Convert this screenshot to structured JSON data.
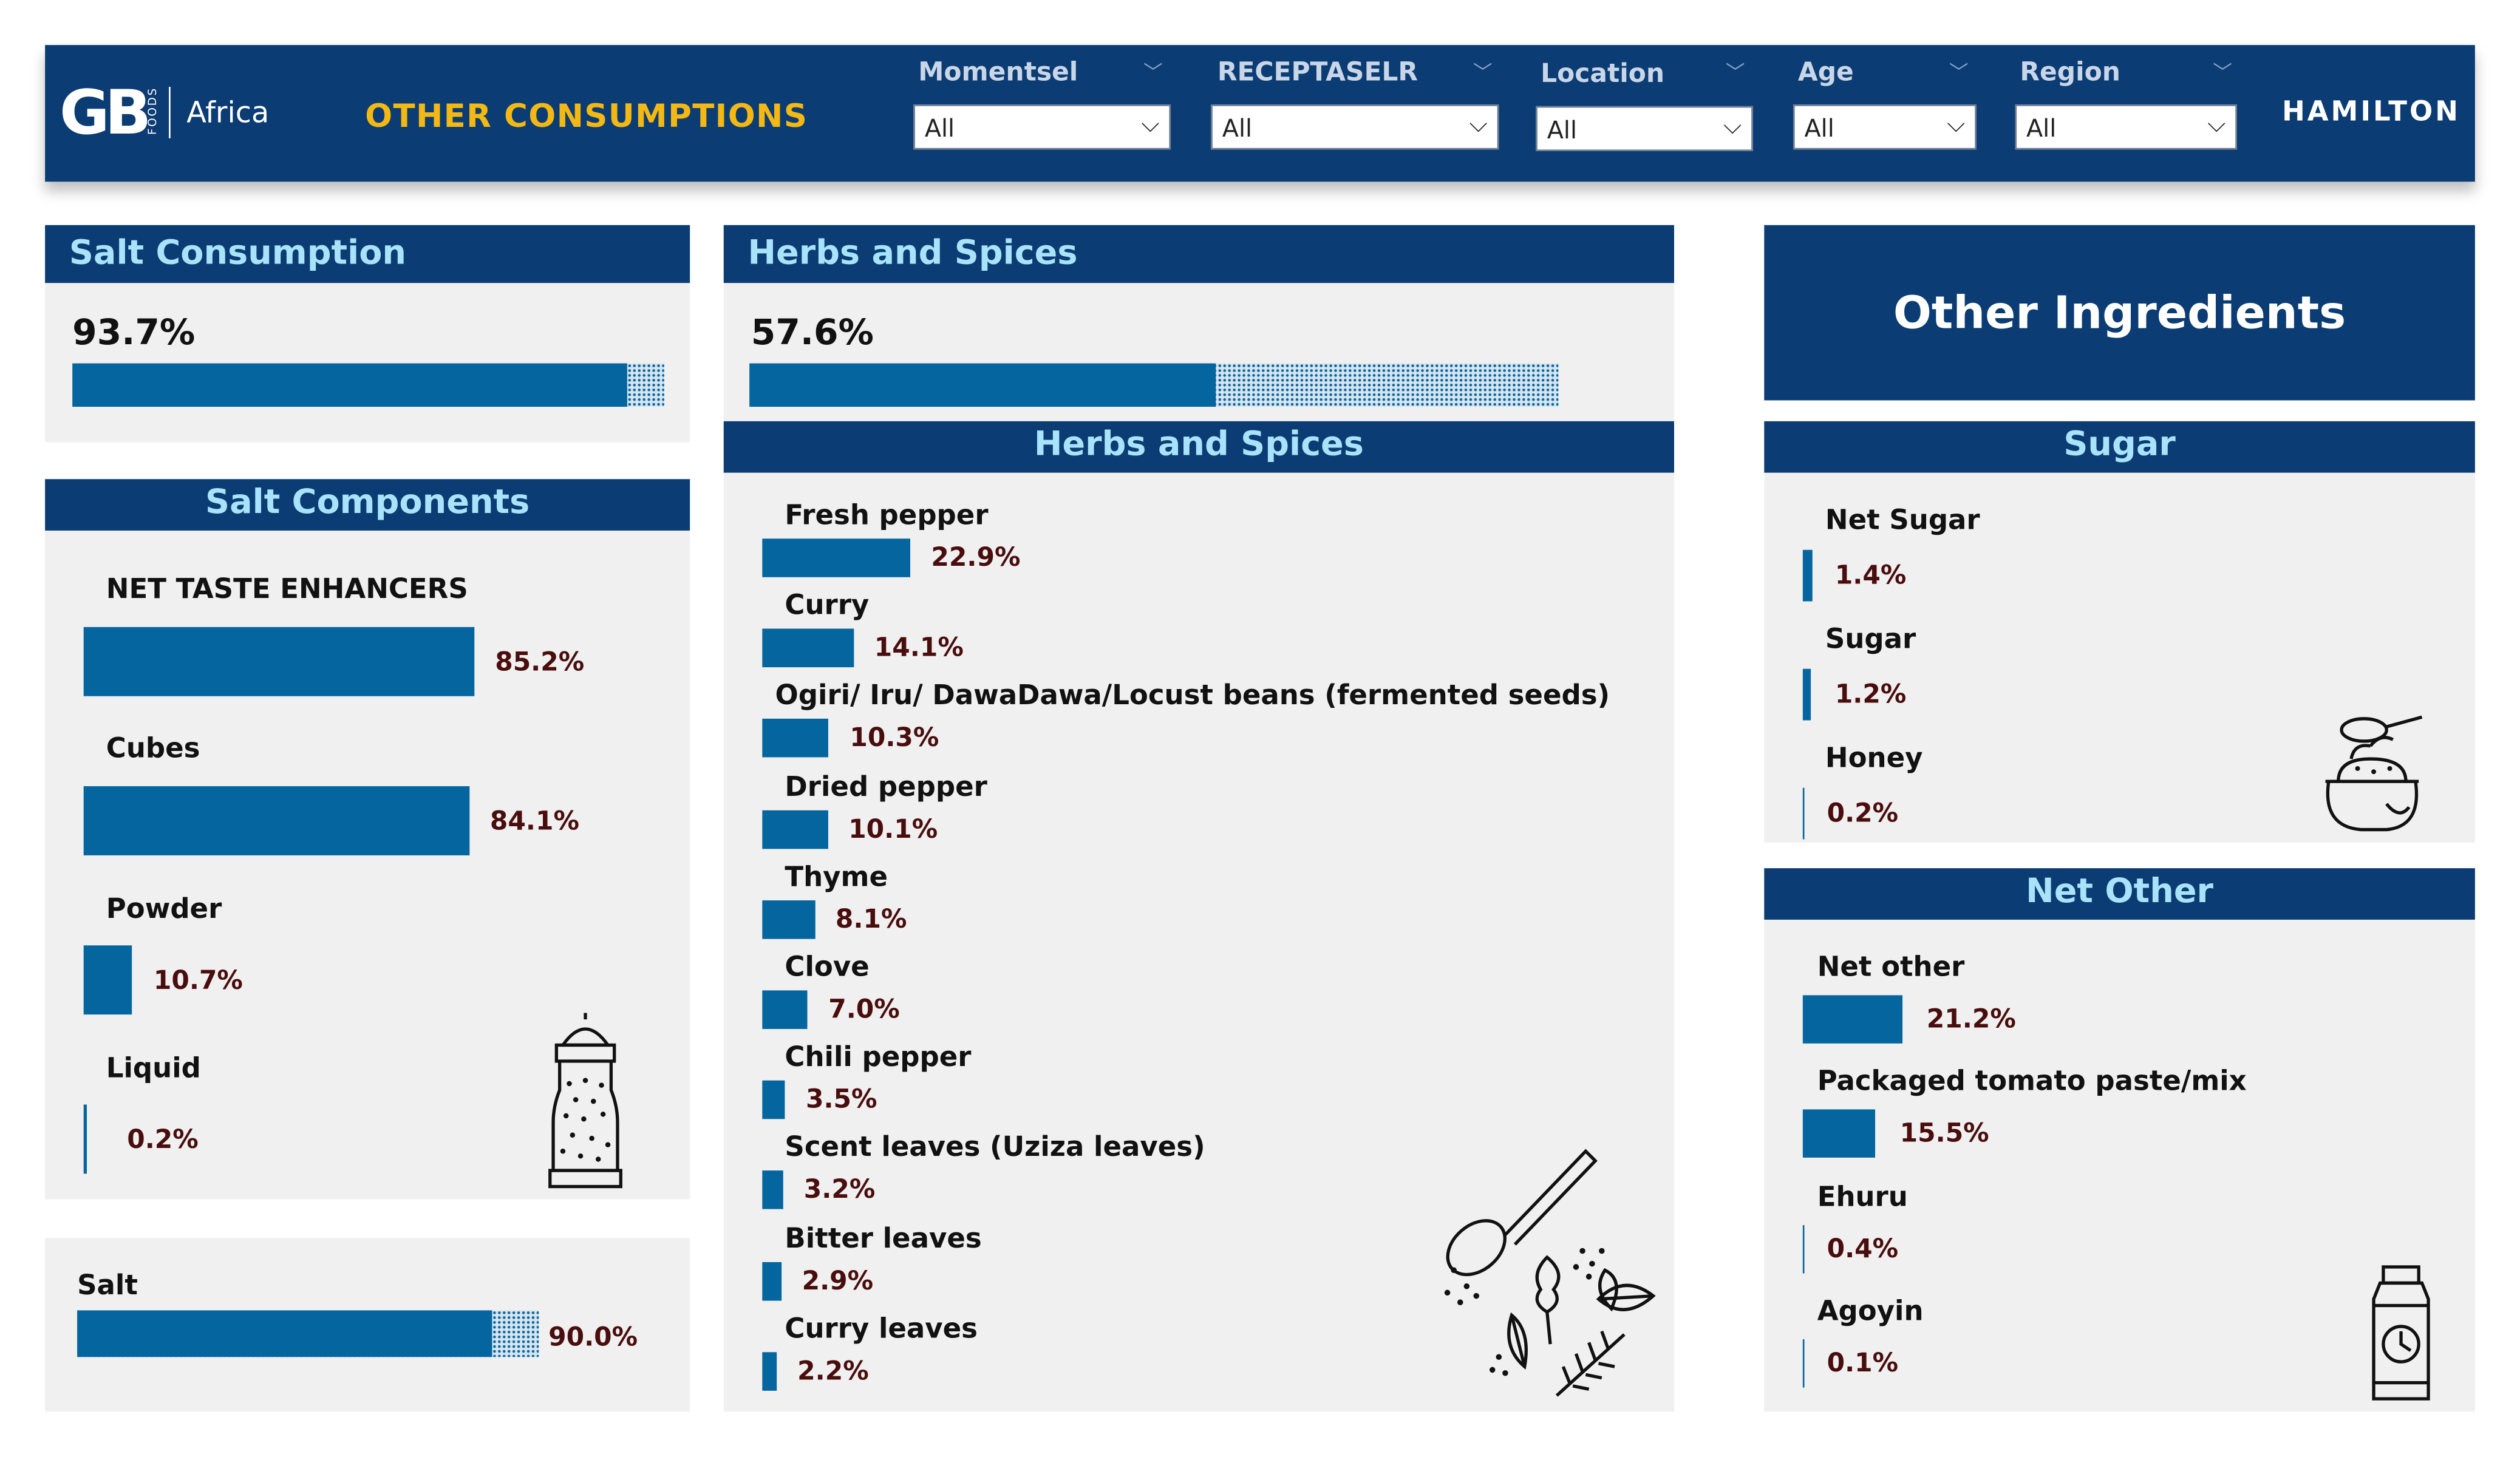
{
  "header": {
    "logo_text": "GB",
    "logo_foods": "FOODS",
    "logo_africa": "Africa",
    "title": "OTHER CONSUMPTIONS",
    "filters": [
      {
        "label": "Momentsel",
        "value": "All"
      },
      {
        "label": "RECEPTASELR",
        "value": "All"
      },
      {
        "label": "Location",
        "value": "All"
      },
      {
        "label": "Age",
        "value": "All"
      },
      {
        "label": "Region",
        "value": "All"
      }
    ],
    "hamilton": "HAMILTON"
  },
  "salt_consumption": {
    "title": "Salt Consumption",
    "value": "93.7%",
    "fraction": 0.937
  },
  "salt_components": {
    "title": "Salt Components",
    "items": [
      {
        "label": "NET TASTE ENHANCERS",
        "value": "85.2%",
        "pct": 85.2
      },
      {
        "label": "Cubes",
        "value": "84.1%",
        "pct": 84.1
      },
      {
        "label": "Powder",
        "value": "10.7%",
        "pct": 10.7
      },
      {
        "label": "Liquid",
        "value": "0.2%",
        "pct": 0.2
      }
    ]
  },
  "salt": {
    "label": "Salt",
    "value": "90.0%",
    "fraction": 0.9
  },
  "herbs_consumption": {
    "title": "Herbs and Spices",
    "value": "57.6%",
    "fraction": 0.576
  },
  "herbs_list": {
    "title": "Herbs and Spices",
    "items": [
      {
        "label": "Fresh pepper",
        "value": "22.9%",
        "pct": 22.9
      },
      {
        "label": "Curry",
        "value": "14.1%",
        "pct": 14.1
      },
      {
        "label": "Ogiri/ Iru/ DawaDawa/Locust beans (fermented seeds)",
        "value": "10.3%",
        "pct": 10.3
      },
      {
        "label": "Dried pepper",
        "value": "10.1%",
        "pct": 10.1
      },
      {
        "label": "Thyme",
        "value": "8.1%",
        "pct": 8.1
      },
      {
        "label": "Clove",
        "value": "7.0%",
        "pct": 7.0
      },
      {
        "label": "Chili pepper",
        "value": "3.5%",
        "pct": 3.5
      },
      {
        "label": "Scent leaves (Uziza leaves)",
        "value": "3.2%",
        "pct": 3.2
      },
      {
        "label": "Bitter leaves",
        "value": "2.9%",
        "pct": 2.9
      },
      {
        "label": "Curry leaves",
        "value": "2.2%",
        "pct": 2.2
      }
    ]
  },
  "other_ingredients": {
    "title": "Other Ingredients"
  },
  "sugar": {
    "title": "Sugar",
    "items": [
      {
        "label": "Net Sugar",
        "value": "1.4%",
        "pct": 1.4
      },
      {
        "label": "Sugar",
        "value": "1.2%",
        "pct": 1.2
      },
      {
        "label": "Honey",
        "value": "0.2%",
        "pct": 0.2
      }
    ]
  },
  "net_other": {
    "title": "Net Other",
    "items": [
      {
        "label": "Net other",
        "value": "21.2%",
        "pct": 21.2
      },
      {
        "label": "Packaged tomato paste/mix",
        "value": "15.5%",
        "pct": 15.5
      },
      {
        "label": "Ehuru",
        "value": "0.4%",
        "pct": 0.4
      },
      {
        "label": "Agoyin",
        "value": "0.1%",
        "pct": 0.1
      }
    ]
  },
  "icons": [
    "salt-shaker-icon",
    "spices-icon",
    "sugar-bowl-icon",
    "bottle-icon"
  ]
}
